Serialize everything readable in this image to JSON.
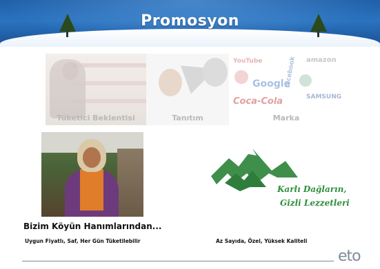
{
  "header": {
    "title": "Promosyon"
  },
  "collage": {
    "panels": [
      {
        "label": "Tüketici Beklentisi"
      },
      {
        "label": "Tanıtım"
      },
      {
        "label": "Marka"
      }
    ],
    "brand_logos": [
      "YouTube",
      "facebook",
      "amazon",
      "Google",
      "Coca-Cola",
      "SAMSUNG"
    ]
  },
  "left_item": {
    "title": "Bizim Köyün Hanımlarından...",
    "subtitle": "Uygun Fiyatlı, Saf, Her Gün Tüketilebilir"
  },
  "right_item": {
    "logo_line1": "Karlı Dağların,",
    "logo_line2": "Gizli Lezzetleri",
    "subtitle": "Az Sayıda, Özel, Yüksek Kaliteli"
  },
  "footer": {
    "logo": "eto"
  },
  "colors": {
    "banner": "#2a73bf",
    "logo_green": "#2e8f3c",
    "footer_gray": "#7d8b98"
  }
}
